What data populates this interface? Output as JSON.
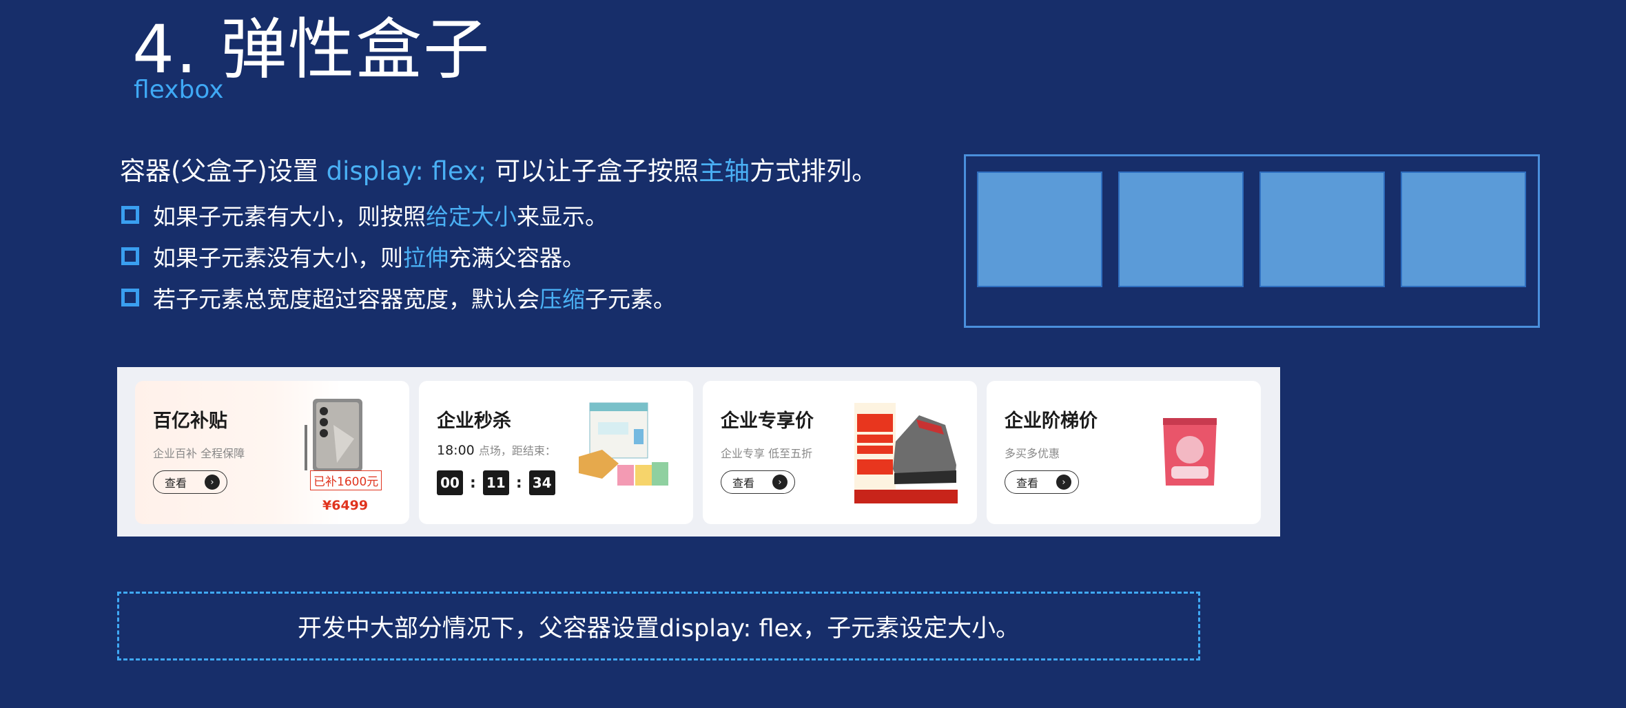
{
  "slide": {
    "title": "4. 弹性盒子",
    "subtitle": "flexbox"
  },
  "intro": {
    "part1": "容器(父盒子)设置 ",
    "code": "display: flex;",
    "part2": " 可以让子盒子按照",
    "highlight": "主轴",
    "part3": "方式排列。"
  },
  "bullets": [
    {
      "before": "如果子元素有大小，则按照",
      "highlight": "给定大小",
      "after": "来显示。"
    },
    {
      "before": "如果子元素没有大小，则",
      "highlight": "拉伸",
      "after": "充满父容器。"
    },
    {
      "before": "若子元素总宽度超过容器宽度，默认会",
      "highlight": "压缩",
      "after": "子元素。"
    }
  ],
  "cards": [
    {
      "title": "百亿补贴",
      "sub": "企业百补 全程保障",
      "button": "查看",
      "tag": "已补1600元",
      "price": "¥6499"
    },
    {
      "title": "企业秒杀",
      "time": "18:00",
      "time_suffix": "点场，距结束：",
      "timer": [
        "00",
        "11",
        "34"
      ]
    },
    {
      "title": "企业专享价",
      "sub": "企业专享 低至五折",
      "button": "查看"
    },
    {
      "title": "企业阶梯价",
      "sub": "多买多优惠",
      "button": "查看"
    }
  ],
  "note": "开发中大部分情况下，父容器设置display: flex，子元素设定大小。",
  "colors": {
    "background": "#172e6a",
    "accent": "#3fa9f5",
    "demo_box": "#5b9bd8",
    "price": "#e0341e"
  },
  "icons": [
    "square-bullet-icon",
    "chevron-right-icon"
  ]
}
